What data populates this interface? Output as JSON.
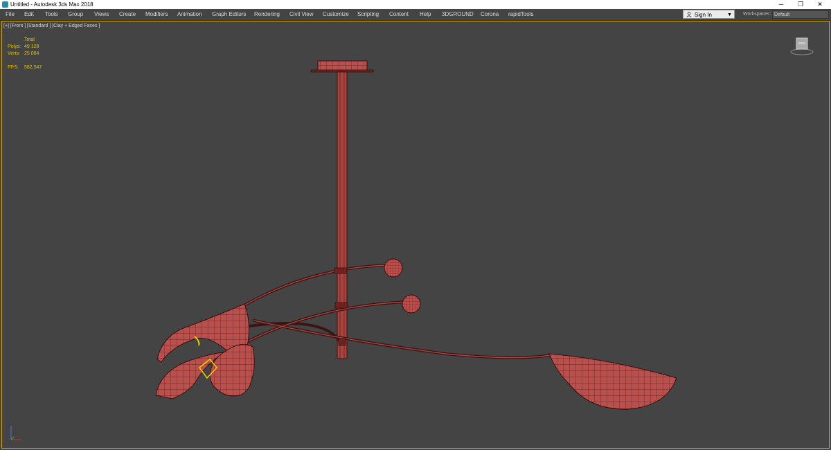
{
  "window": {
    "title": "Untitled - Autodesk 3ds Max 2018",
    "controls": {
      "minimize": "─",
      "restore": "❐",
      "close": "✕"
    }
  },
  "menu": [
    "File",
    "Edit",
    "Tools",
    "Group",
    "Views",
    "Create",
    "Modifiers",
    "Animation",
    "Graph Editors",
    "Rendering",
    "Civil View",
    "Customize",
    "Scripting",
    "Content",
    "Help",
    "3DGROUND",
    "Corona",
    "rapidTools"
  ],
  "account": {
    "sign_in_label": "Sign In",
    "user_icon": "user-icon"
  },
  "workspaces": {
    "label": "Workspaces:",
    "value": "Default"
  },
  "viewport": {
    "label": "[+] [Front ] [Standard ] [Clay + Edged Faces ]",
    "stats": {
      "total_label": "Total",
      "polys_label": "Polys:",
      "polys_value": "49 128",
      "verts_label": "Verts:",
      "verts_value": "25 084",
      "fps_label": "FPS:",
      "fps_value": "582,547"
    },
    "viewcube_icon": "viewcube-icon",
    "axis_icon": "axis-tripod-icon"
  },
  "colors": {
    "model_fill": "#b8504d",
    "model_wire": "#5a1a1a",
    "selection": "#e8d000",
    "viewport_bg": "#444444",
    "stats_text": "#e3c000"
  }
}
